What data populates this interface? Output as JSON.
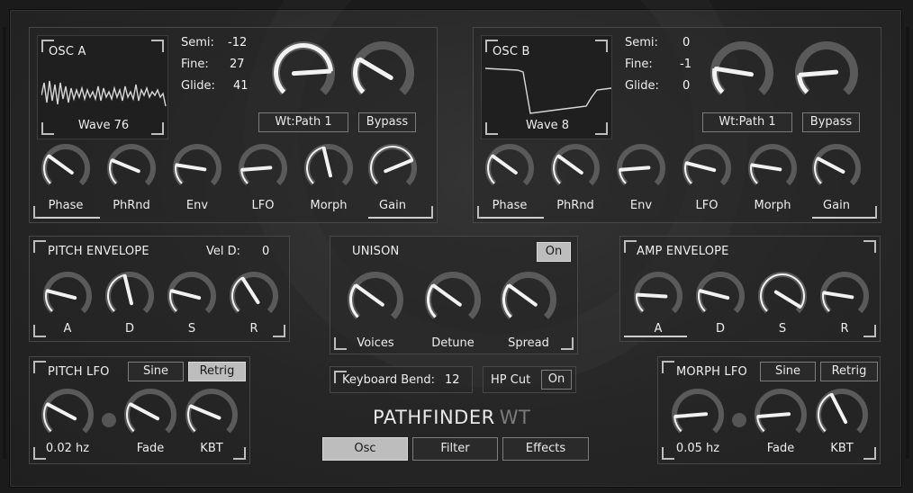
{
  "osc_a": {
    "title": "OSC A",
    "wave_name": "Wave 76",
    "semi_label": "Semi:",
    "semi_value": "-12",
    "fine_label": "Fine:",
    "fine_value": "27",
    "glide_label": "Glide:",
    "glide_value": "41",
    "wt_path_label": "Wt:Path 1",
    "bypass_label": "Bypass",
    "knobs": {
      "phase": "Phase",
      "phrnd": "PhRnd",
      "env": "Env",
      "lfo": "LFO",
      "morph": "Morph",
      "gain": "Gain"
    }
  },
  "osc_b": {
    "title": "OSC B",
    "wave_name": "Wave 8",
    "semi_label": "Semi:",
    "semi_value": "0",
    "fine_label": "Fine:",
    "fine_value": "-1",
    "glide_label": "Glide:",
    "glide_value": "0",
    "wt_path_label": "Wt:Path 1",
    "bypass_label": "Bypass",
    "knobs": {
      "phase": "Phase",
      "phrnd": "PhRnd",
      "env": "Env",
      "lfo": "LFO",
      "morph": "Morph",
      "gain": "Gain"
    }
  },
  "pitch_envelope": {
    "title": "PITCH ENVELOPE",
    "vel_label": "Vel D:",
    "vel_value": "0",
    "knobs": {
      "a": "A",
      "d": "D",
      "s": "S",
      "r": "R"
    }
  },
  "unison": {
    "title": "UNISON",
    "toggle_label": "On",
    "knobs": {
      "voices": "Voices",
      "detune": "Detune",
      "spread": "Spread"
    }
  },
  "amp_envelope": {
    "title": "AMP ENVELOPE",
    "knobs": {
      "a": "A",
      "d": "D",
      "s": "S",
      "r": "R"
    }
  },
  "keyboard_bend": {
    "label": "Keyboard Bend:",
    "value": "12"
  },
  "hp_cut": {
    "label": "HP Cut",
    "toggle_label": "On"
  },
  "pitch_lfo": {
    "title": "PITCH LFO",
    "shape_label": "Sine",
    "retrig_label": "Retrig",
    "rate_value": "0.02 hz",
    "fade_label": "Fade",
    "kbt_label": "KBT"
  },
  "morph_lfo": {
    "title": "MORPH LFO",
    "shape_label": "Sine",
    "retrig_label": "Retrig",
    "rate_value": "0.05 hz",
    "fade_label": "Fade",
    "kbt_label": "KBT"
  },
  "logo": {
    "main": "PATHFINDER",
    "suffix": "WT"
  },
  "nav": {
    "osc": "Osc",
    "filter": "Filter",
    "effects": "Effects",
    "active": "Osc"
  },
  "knob_values": {
    "osc_a_big_1": 0.82,
    "osc_a_big_2": 0.28,
    "osc_a_phase": 0.3,
    "osc_a_phrnd": 0.25,
    "osc_a_env": 0.2,
    "osc_a_lfo": 0.15,
    "osc_a_morph": 0.45,
    "osc_a_gain": 0.75,
    "osc_b_big_1": 0.2,
    "osc_b_big_2": 0.15,
    "osc_b_phase": 0.3,
    "osc_b_phrnd": 0.3,
    "osc_b_env": 0.15,
    "osc_b_lfo": 0.22,
    "osc_b_morph": 0.2,
    "osc_b_gain": 0.27,
    "penv_a": 0.22,
    "penv_d": 0.45,
    "penv_s": 0.22,
    "penv_r": 0.38,
    "unison_voices": 0.3,
    "unison_detune": 0.3,
    "unison_spread": 0.3,
    "aenv_a": 0.18,
    "aenv_d": 0.22,
    "aenv_s": 0.95,
    "aenv_r": 0.2,
    "plfo_rate": 0.27,
    "plfo_fade": 0.27,
    "plfo_kbt": 0.25,
    "mlfo_rate": 0.15,
    "mlfo_fade": 0.15,
    "mlfo_kbt": 0.4
  },
  "colors": {
    "accent_knob": "#f2f2f2",
    "knob_track": "#5a5a5a",
    "button_active": "#bdbdbd"
  }
}
